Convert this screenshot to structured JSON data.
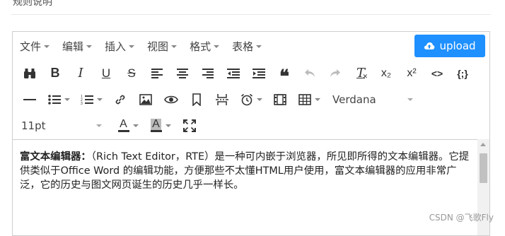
{
  "page": {
    "cut_heading": "规则说明"
  },
  "menubar": {
    "items": [
      {
        "label": "文件"
      },
      {
        "label": "编辑"
      },
      {
        "label": "插入"
      },
      {
        "label": "视图"
      },
      {
        "label": "格式"
      },
      {
        "label": "表格"
      }
    ],
    "upload_label": "upload"
  },
  "toolbar": {
    "font_family": "Verdana",
    "font_size": "11pt",
    "bold": "B",
    "italic": "I",
    "underline": "U",
    "strike": "S",
    "quote": "❝",
    "clear_format": "T",
    "subscript": "x₂",
    "superscript": "x²",
    "code": "<>",
    "code_block": "{;}",
    "font_color": "A",
    "bg_color": "A"
  },
  "content": {
    "bold_term": "富文本编辑器：",
    "paragraph": "（Rich Text Editor，RTE）是一种可内嵌于浏览器，所见即所得的文本编辑器。它提供类似于Office Word 的编辑功能，方便那些不太懂HTML用户使用，富文本编辑器的应用非常广泛，它的历史与图文网页诞生的历史几乎一样长。"
  },
  "watermark": "CSDN @飞歌Fly",
  "colors": {
    "accent": "#1e90ff",
    "border": "#cfcfcf"
  }
}
